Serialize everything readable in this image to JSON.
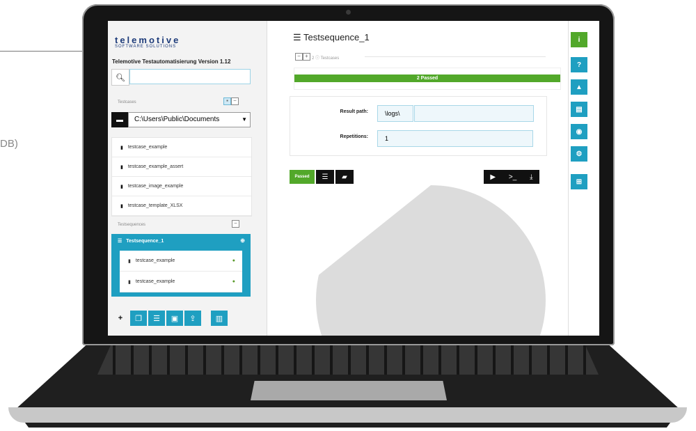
{
  "callout": {
    "text": "DB)"
  },
  "app": {
    "logo": "telemotive",
    "logo_sub": "SOFTWARE SOLUTIONS",
    "version_label": "Telemotive Testautomatisierung Version 1.12"
  },
  "sidebar": {
    "search": {
      "placeholder": ""
    },
    "testcases_label": "Testcases",
    "path": "C:\\Users\\Public\\Documents",
    "testcases": [
      {
        "label": "testcase_example"
      },
      {
        "label": "testcase_example_assert"
      },
      {
        "label": "testcase_image_example"
      },
      {
        "label": "testcase_template_XLSX"
      }
    ],
    "testsequences_label": "Testsequences",
    "sequence": {
      "label": "Testsequence_1",
      "items": [
        {
          "label": "testcase_example"
        },
        {
          "label": "testcase_example"
        }
      ]
    }
  },
  "main": {
    "title": "Testsequence_1",
    "subtitle": "2 ⓘ Testcases",
    "progress_label": "2 Passed",
    "progress": 1.0,
    "result_path_label": "Result path:",
    "result_path_value": "\\logs\\",
    "repetitions_label": "Repetitions:",
    "repetitions_value": "1",
    "status_button": "Passed"
  },
  "colors": {
    "accent": "#1f9fc1",
    "success": "#52a82a",
    "brand": "#1d3b7a"
  },
  "icons": [
    "search-icon",
    "folder-icon",
    "file-icon",
    "list-icon",
    "play-icon",
    "terminal-icon",
    "download-icon",
    "info-icon",
    "help-icon",
    "graduation-icon",
    "book-icon",
    "globe-icon",
    "cogs-icon",
    "network-icon",
    "trash-icon",
    "save-icon",
    "upload-icon",
    "copy-icon",
    "plus-icon",
    "minus-icon",
    "image-icon"
  ]
}
